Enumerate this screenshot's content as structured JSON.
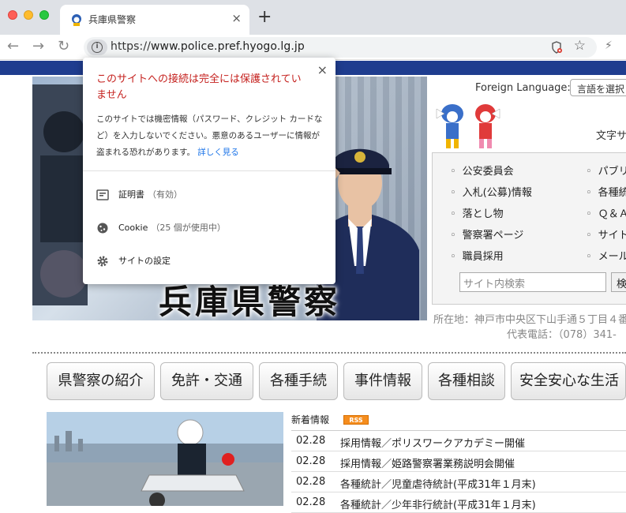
{
  "browser": {
    "tab_title": "兵庫県警察",
    "tab_close": "×",
    "new_tab": "+",
    "url_scheme": "https://",
    "url_host": "www.police.pref.hyogo.lg.jp"
  },
  "popup": {
    "title": "このサイトへの接続は完全には保護されていません",
    "description": "このサイトでは機密情報（パスワード、クレジット カードなど）を入力しないでください。悪意のあるユーザーに情報が盗まれる恐れがあります。",
    "learn_more": "詳しく見る",
    "close": "×",
    "certificate_label": "証明書",
    "certificate_status": "（有効）",
    "cookie_label": "Cookie",
    "cookie_status": "（25 個が使用中）",
    "site_settings_label": "サイトの設定"
  },
  "header": {
    "hero_title": "兵庫県警察",
    "foreign_language_label": "Foreign Language:",
    "language_select": "言語を選択",
    "text_size_label": "文字サ"
  },
  "quicklinks": {
    "items": [
      "公安委員会",
      "入札(公募)情報",
      "落とし物",
      "警察署ページ",
      "職員採用"
    ],
    "items_right": [
      "パブリ",
      "各種統",
      "Ｑ＆Ａ",
      "サイト",
      "メール"
    ],
    "search_placeholder": "サイト内検索",
    "search_button": "検"
  },
  "contact": {
    "address": "所在地：神戸市中央区下山手通５丁目４番",
    "phone": "代表電話：（078）341-"
  },
  "nav_buttons": [
    "県警察の紹介",
    "免許・交通",
    "各種手続",
    "事件情報",
    "各種相談",
    "安全安心な生活"
  ],
  "news": {
    "heading": "新着情報",
    "rss": "RSS",
    "items": [
      {
        "date": "02.28",
        "title": "採用情報／ポリスワークアカデミー開催"
      },
      {
        "date": "02.28",
        "title": "採用情報／姫路警察署業務説明会開催"
      },
      {
        "date": "02.28",
        "title": "各種統計／児童虐待統計(平成31年１月末)"
      },
      {
        "date": "02.28",
        "title": "各種統計／少年非行統計(平成31年１月末)"
      }
    ]
  },
  "colors": {
    "site_bar": "#1f3d8f",
    "warning_red": "#c5221f",
    "link_blue": "#1a73e8",
    "rss_orange": "#f58d1e"
  }
}
